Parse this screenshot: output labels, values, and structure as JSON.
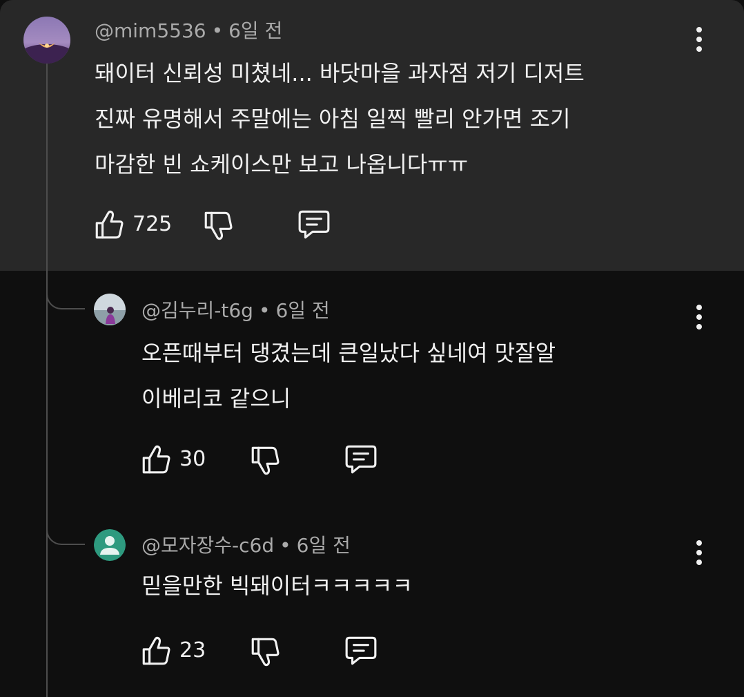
{
  "comments": [
    {
      "handle": "@mim5536",
      "time": "6일 전",
      "lines": [
        "돼이터 신뢰성 미쳤네... 바닷마을 과자점 저기 디저트",
        "진짜 유명해서 주말에는 아침 일찍 빨리 안가면 조기",
        "마감한 빈 쇼케이스만 보고 나옵니다ㅠㅠ"
      ],
      "likes": "725",
      "avatar_icon": "night-sky-avatar-icon"
    }
  ],
  "replies": [
    {
      "handle": "@김누리-t6g",
      "time": "6일 전",
      "lines": [
        "오픈때부터 댕겼는데 큰일났다 싶네여 맛잘알",
        "이베리코 같으니"
      ],
      "likes": "30",
      "avatar_icon": "photo-avatar-icon"
    },
    {
      "handle": "@모자장수-c6d",
      "time": "6일 전",
      "lines": [
        "믿을만한 빅돼이터ㅋㅋㅋㅋㅋ"
      ],
      "likes": "23",
      "avatar_icon": "default-person-avatar-icon",
      "avatar_color": "#2e9a7f"
    }
  ],
  "icons": {
    "like": "thumbs-up-icon",
    "dislike": "thumbs-down-icon",
    "reply": "reply-comment-icon",
    "more": "more-vertical-icon"
  },
  "colors": {
    "page_bg": "#0f0f0f",
    "highlight_bg": "#282828",
    "text_primary": "#f1f1f1",
    "text_secondary": "#aaaaaa",
    "thread_line": "#4d4d4d"
  }
}
